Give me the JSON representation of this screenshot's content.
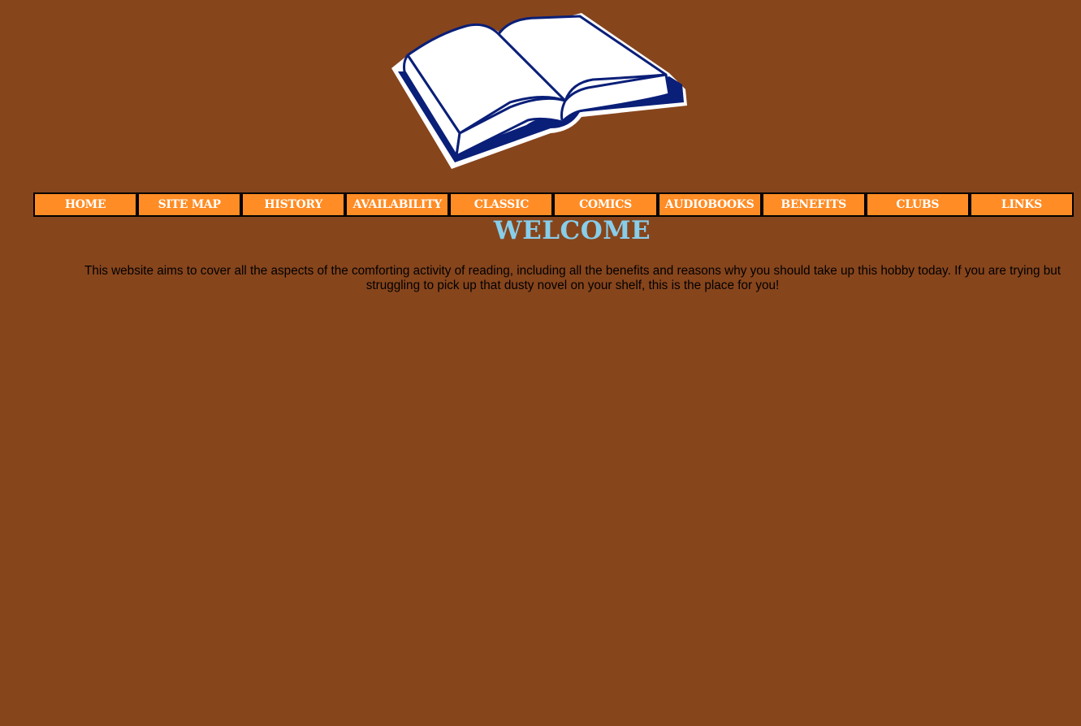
{
  "logo": {
    "icon": "open-book-icon"
  },
  "nav": {
    "items": [
      {
        "label": "HOME"
      },
      {
        "label": "SITE MAP"
      },
      {
        "label": "HISTORY"
      },
      {
        "label": "AVAILABILITY"
      },
      {
        "label": "CLASSIC"
      },
      {
        "label": "COMICS"
      },
      {
        "label": "AUDIOBOOKS"
      },
      {
        "label": "BENEFITS"
      },
      {
        "label": "CLUBS"
      },
      {
        "label": "LINKS"
      }
    ]
  },
  "main": {
    "title": "WELCOME",
    "intro": "This website aims to cover all the aspects of the comforting activity of reading, including all the benefits and reasons why you should take up this hobby today. If you are trying but struggling to pick up that dusty novel on your shelf, this is the place for you!"
  },
  "colors": {
    "background": "#87451c",
    "nav_bg": "#ff8c24",
    "nav_text": "#ffffff",
    "title": "#87ceeb",
    "book_cover": "#0a1f78"
  }
}
